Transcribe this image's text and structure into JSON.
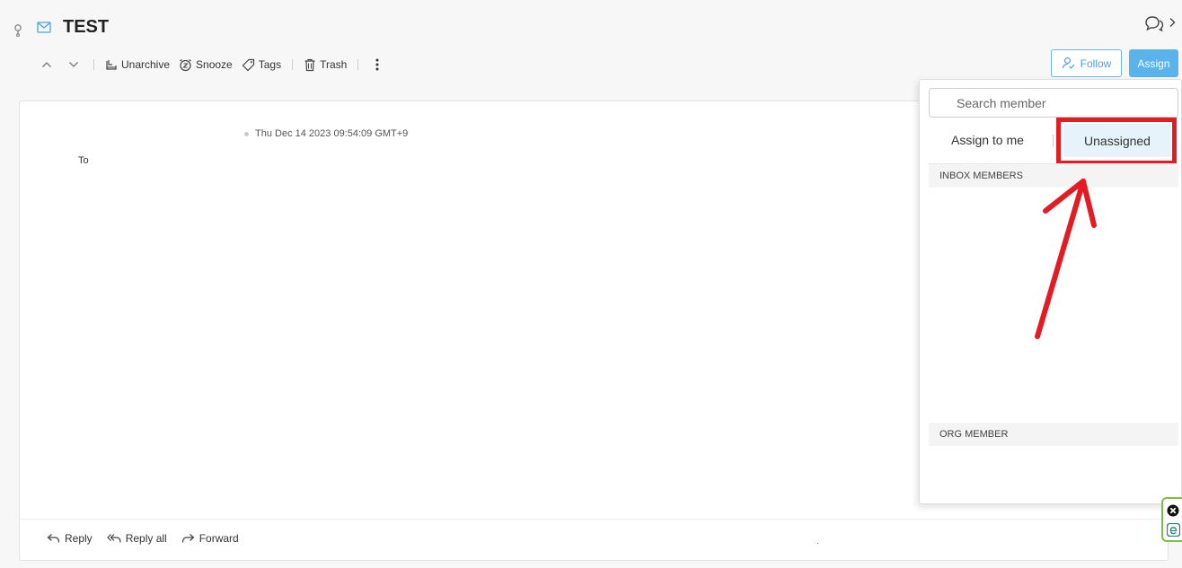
{
  "header": {
    "title": "TEST",
    "icons": {
      "pin": "pin-icon",
      "mail": "envelope-icon",
      "chat": "chat-bubbles-icon",
      "collapse": "chevron-right-icon"
    }
  },
  "toolbar": {
    "unarchive_label": "Unarchive",
    "snooze_label": "Snooze",
    "tags_label": "Tags",
    "trash_label": "Trash",
    "follow_label": "Follow",
    "assign_label": "Assign"
  },
  "message": {
    "date": "Thu Dec 14 2023 09:54:09 GMT+9",
    "to_label": "To"
  },
  "footer": {
    "reply_label": "Reply",
    "reply_all_label": "Reply all",
    "forward_label": "Forward"
  },
  "assign_dropdown": {
    "search_placeholder": "Search member",
    "assign_to_me_label": "Assign to me",
    "unassigned_label": "Unassigned",
    "section_inbox": "INBOX MEMBERS",
    "section_org": "ORG MEMBER"
  },
  "colors": {
    "accent": "#5ab3ea",
    "highlight": "#e31b23",
    "selected_bg": "#e6f3fb"
  }
}
